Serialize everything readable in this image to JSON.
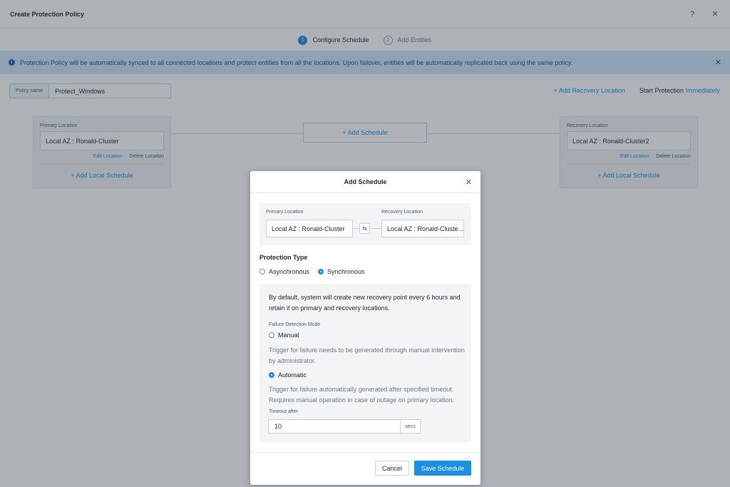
{
  "window": {
    "title": "Create Protection Policy",
    "help_glyph": "?",
    "close_glyph": "✕"
  },
  "steps": [
    {
      "num": "1",
      "label": "Configure Schedule"
    },
    {
      "num": "2",
      "label": "Add Entities"
    }
  ],
  "banner": {
    "text": "Protection Policy will be automatically synced to all connected locations and protect entities from all the locations. Upon failover, entities will be automatically replicated back using the same policy.",
    "info_glyph": "i",
    "close_glyph": "✕"
  },
  "policy": {
    "label": "Policy name",
    "value": "Protect_Windows"
  },
  "toplinks": {
    "add_recovery": "+ Add Recovery Location",
    "start_protection": "Start Protection",
    "start_mode": "Immediately"
  },
  "primary_card": {
    "heading": "Primary Location",
    "value": "Local AZ : Ronald-Cluster",
    "edit": "Edit Location",
    "delete": "Delete Location",
    "add_schedule": "+   Add Local Schedule"
  },
  "recovery_card": {
    "heading": "Recovery Location",
    "value": "Local AZ : Ronald-Cluster2",
    "edit": "Edit Location",
    "delete": "Delete Location",
    "add_schedule": "+   Add Local Schedule"
  },
  "center": {
    "add_schedule": "+ Add Schedule"
  },
  "modal": {
    "title": "Add Schedule",
    "close_glyph": "✕",
    "primary_caption": "Primary Location",
    "primary_value": "Local AZ : Ronald-Cluster",
    "recovery_caption": "Recovery Location",
    "recovery_value": "Local AZ : Ronald-Cluste...",
    "swap_glyph": "⇆",
    "protection_type_title": "Protection Type",
    "options": {
      "async": "Asynchronous",
      "sync": "Synchronous"
    },
    "description": "By default, system will create new recovery point every 6 hours and retain it on primary and recovery locations.",
    "failure_detection_title": "Failure Detection Mode",
    "manual_label": "Manual",
    "manual_note": "Trigger for failure needs to be generated through manual intervention by administrator.",
    "automatic_label": "Automatic",
    "automatic_note": "Trigger for failure automatically generated after specified timeout. Requires manual operation in case of outage on primary location.",
    "timeout_label": "Timeout after",
    "timeout_value": "10",
    "timeout_unit": "secs",
    "cancel": "Cancel",
    "save": "Save Schedule"
  },
  "colors": {
    "accent": "#1b8fe0",
    "banner_bg": "#cfe4f7",
    "banner_text": "#1d4f8a"
  }
}
